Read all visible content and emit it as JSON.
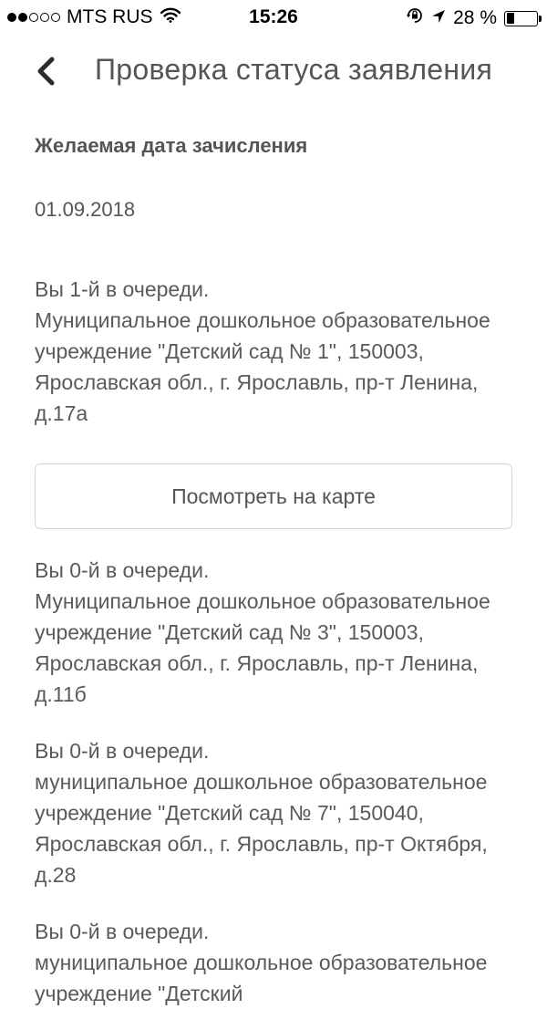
{
  "status_bar": {
    "carrier": "MTS RUS",
    "time": "15:26",
    "battery_percent": "28 %",
    "battery_level": 0.28,
    "signal_bars_filled": 2,
    "signal_bars_total": 5,
    "icons": [
      "wifi-icon",
      "rotation-lock-icon",
      "location-arrow-icon",
      "battery-icon"
    ]
  },
  "nav": {
    "title": "Проверка статуса заявления",
    "back_icon": "chevron-left-icon"
  },
  "enrollment": {
    "heading": "Желаемая дата зачисления",
    "date": "01.09.2018"
  },
  "entries": [
    {
      "queue": "Вы 1-й в очереди.",
      "org": "Муниципальное дошкольное образовательное учреждение \"Детский сад № 1\", 150003, Ярославская обл., г. Ярославль, пр-т Ленина, д.17а"
    },
    {
      "queue": "Вы 0-й в очереди.",
      "org": "Муниципальное дошкольное образовательное учреждение \"Детский сад № 3\", 150003, Ярославская обл., г. Ярославль, пр-т Ленина, д.11б"
    },
    {
      "queue": "Вы 0-й в очереди.",
      "org": "муниципальное дошкольное образовательное учреждение \"Детский сад № 7\", 150040, Ярославская обл., г. Ярославль, пр-т Октября, д.28"
    },
    {
      "queue": "Вы 0-й в очереди.",
      "org": "муниципальное дошкольное образовательное учреждение \"Детский"
    }
  ],
  "map_button": {
    "label": "Посмотреть на карте"
  }
}
